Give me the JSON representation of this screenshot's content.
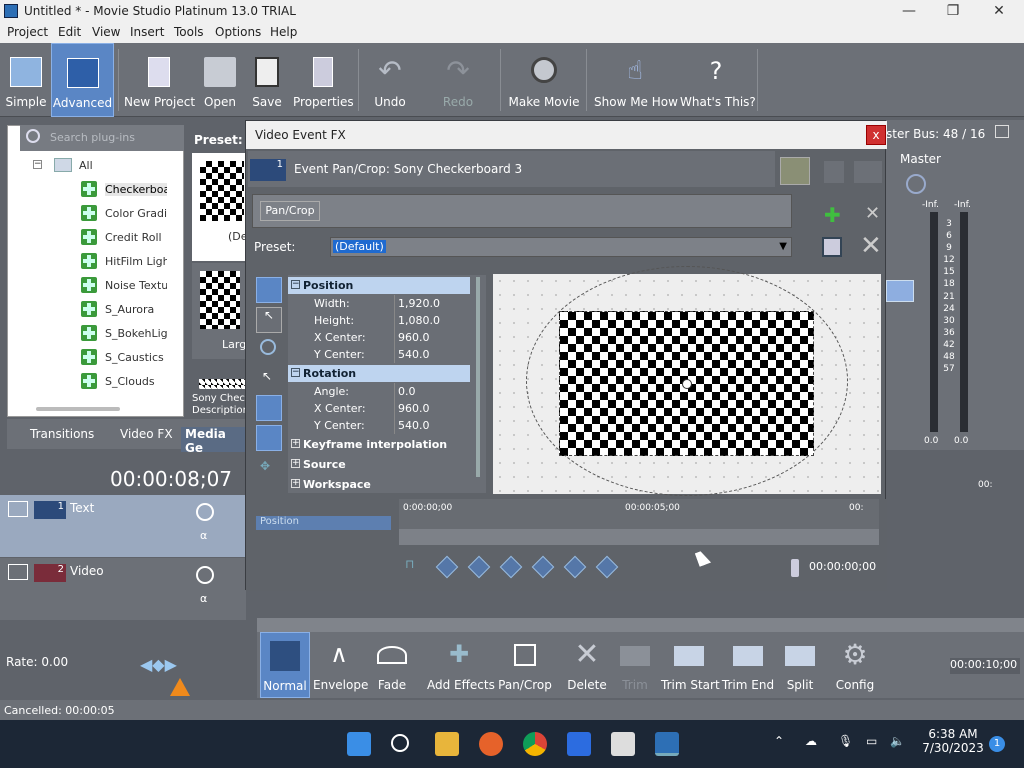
{
  "window": {
    "title": "Untitled * - Movie Studio Platinum 13.0 TRIAL",
    "minimize": "—",
    "maximize": "❐",
    "close": "✕"
  },
  "menu": [
    "Project",
    "Edit",
    "View",
    "Insert",
    "Tools",
    "Options",
    "Help"
  ],
  "toolbar": [
    {
      "label": "Simple",
      "icon": "simple-view-icon"
    },
    {
      "label": "Advanced",
      "icon": "advanced-view-icon",
      "active": true
    },
    {
      "label": "New Project",
      "icon": "new-project-icon"
    },
    {
      "label": "Open",
      "icon": "open-folder-icon"
    },
    {
      "label": "Save",
      "icon": "save-disk-icon"
    },
    {
      "label": "Properties",
      "icon": "properties-icon"
    },
    {
      "label": "Undo",
      "icon": "undo-icon"
    },
    {
      "label": "Redo",
      "icon": "redo-icon",
      "disabled": true
    },
    {
      "label": "Make Movie",
      "icon": "film-reel-icon"
    },
    {
      "label": "Show Me How",
      "icon": "hand-pointer-icon"
    },
    {
      "label": "What's This?",
      "icon": "help-cursor-icon"
    }
  ],
  "left_panel": {
    "search_placeholder": "Search plug-ins",
    "root": "All",
    "items": [
      "Checkerboar",
      "Color Gradier",
      "Credit Roll",
      "HitFilm Light I",
      "Noise Textur",
      "S_Aurora",
      "S_BokehLight",
      "S_Caustics",
      "S_Clouds"
    ],
    "tabs": [
      "Transitions",
      "Video FX",
      "Media Ge"
    ]
  },
  "preset_panel": {
    "label": "Preset:",
    "thumb1": "(De",
    "thumb2": "Larg",
    "desc": "Sony Chec",
    "desc2": "Description"
  },
  "dialog": {
    "title": "Video Event FX",
    "close": "x",
    "fx_header": "Event Pan/Crop:  Sony Checkerboard 3",
    "track_num": "1",
    "chain_button": "Pan/Crop",
    "preset_label": "Preset:",
    "preset_value": "(Default)",
    "props": {
      "position": {
        "title": "Position",
        "rows": [
          [
            "Width:",
            "1,920.0"
          ],
          [
            "Height:",
            "1,080.0"
          ],
          [
            "X Center:",
            "960.0"
          ],
          [
            "Y Center:",
            "540.0"
          ]
        ]
      },
      "rotation": {
        "title": "Rotation",
        "rows": [
          [
            "Angle:",
            "0.0"
          ],
          [
            "X Center:",
            "960.0"
          ],
          [
            "Y Center:",
            "540.0"
          ]
        ]
      },
      "collapsed": [
        "Keyframe interpolation",
        "Source",
        "Workspace"
      ]
    },
    "kf_label": "Position",
    "ruler": [
      "0:00:00;00",
      "00:00:05;00",
      "00:"
    ],
    "kf_time": "00:00:00;00"
  },
  "mixer": {
    "title": "ster Bus: 48 / 16",
    "master": "Master",
    "inf1": "-Inf.",
    "inf2": "-Inf.",
    "scale": [
      "3",
      "6",
      "9",
      "12",
      "15",
      "18",
      "21",
      "24",
      "30",
      "36",
      "42",
      "48",
      "57"
    ],
    "zero1": "0.0",
    "zero2": "0.0"
  },
  "timeline": {
    "timecode": "00:00:08;07",
    "tracks": [
      {
        "num": "1",
        "name": "Text"
      },
      {
        "num": "2",
        "name": "Video"
      }
    ],
    "ruler_right": "00:"
  },
  "edit_toolbar": [
    {
      "label": "Normal",
      "icon": "normal-tool-icon",
      "active": true
    },
    {
      "label": "Envelope",
      "icon": "envelope-tool-icon"
    },
    {
      "label": "Fade",
      "icon": "fade-tool-icon"
    },
    {
      "label": "Add Effects",
      "icon": "add-effects-icon"
    },
    {
      "label": "Pan/Crop",
      "icon": "pan-crop-icon"
    },
    {
      "label": "Delete",
      "icon": "delete-x-icon"
    },
    {
      "label": "Trim",
      "icon": "trim-icon",
      "disabled": true
    },
    {
      "label": "Trim Start",
      "icon": "trim-start-icon"
    },
    {
      "label": "Trim End",
      "icon": "trim-end-icon"
    },
    {
      "label": "Split",
      "icon": "split-icon"
    },
    {
      "label": "Config",
      "icon": "gear-icon"
    }
  ],
  "rate": "Rate: 0.00",
  "right_time": "00:00:10;00",
  "status": "Cancelled: 00:00:05",
  "taskbar": {
    "time": "6:38 AM",
    "date": "7/30/2023",
    "badge": "1"
  }
}
